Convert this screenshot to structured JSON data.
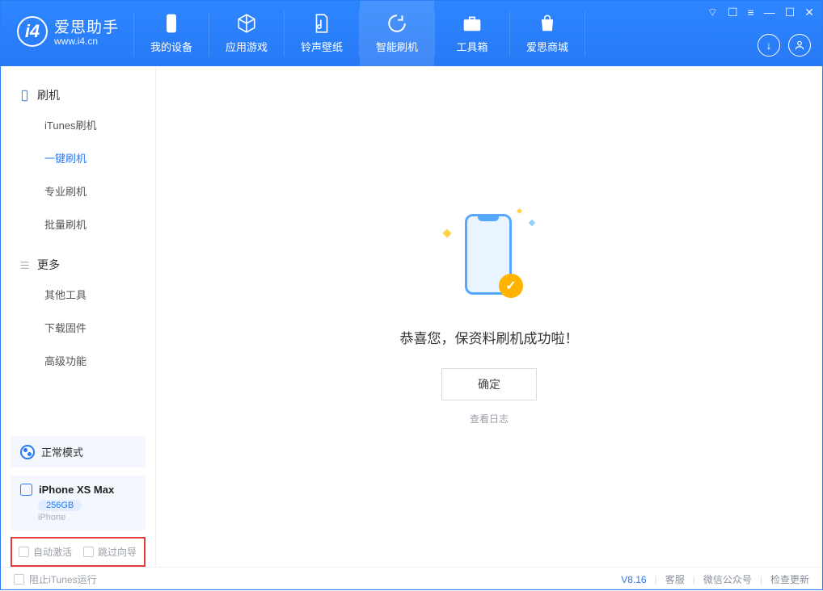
{
  "app": {
    "title": "爱思助手",
    "url": "www.i4.cn"
  },
  "nav": {
    "my_device": "我的设备",
    "apps_games": "应用游戏",
    "ringtones": "铃声壁纸",
    "flash": "智能刷机",
    "toolbox": "工具箱",
    "store": "爱思商城"
  },
  "sidebar": {
    "group_flash": "刷机",
    "itunes_flash": "iTunes刷机",
    "one_click": "一键刷机",
    "pro_flash": "专业刷机",
    "batch_flash": "批量刷机",
    "group_more": "更多",
    "other_tools": "其他工具",
    "download_fw": "下载固件",
    "advanced": "高级功能"
  },
  "mode": {
    "label": "正常模式"
  },
  "device": {
    "name": "iPhone XS Max",
    "capacity": "256GB",
    "type": "iPhone"
  },
  "options": {
    "auto_activate": "自动激活",
    "skip_guide": "跳过向导"
  },
  "main": {
    "success_msg": "恭喜您，保资料刷机成功啦！",
    "confirm": "确定",
    "view_log": "查看日志"
  },
  "footer": {
    "block_itunes": "阻止iTunes运行",
    "version": "V8.16",
    "support": "客服",
    "wechat": "微信公众号",
    "check_update": "检查更新"
  }
}
